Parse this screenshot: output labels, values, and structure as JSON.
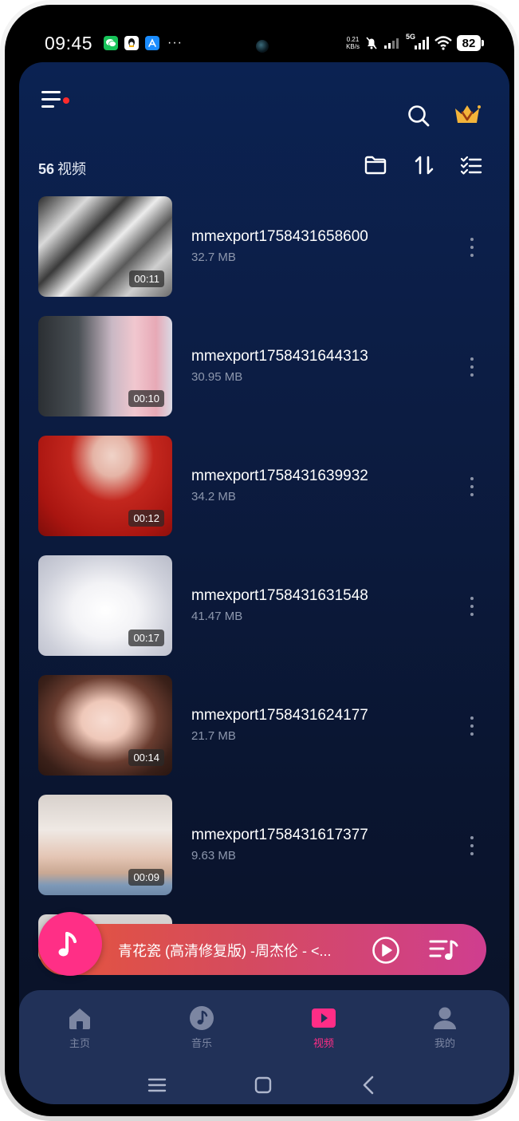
{
  "status_bar": {
    "time": "09:45",
    "net_speed_value": "0.21",
    "net_speed_unit": "KB/s",
    "signal_tag": "5G",
    "battery": "82",
    "more": "···"
  },
  "header": {
    "menu_icon": "menu-icon",
    "search_icon": "search-icon",
    "vip_icon": "crown-icon"
  },
  "toolbar": {
    "count": "56",
    "count_unit": "视频",
    "folder_icon": "folder-icon",
    "sort_icon": "sort-icon",
    "select_icon": "checklist-icon"
  },
  "videos": [
    {
      "title": "mmexport1758431658600",
      "size": "32.7 MB",
      "duration": "00:11"
    },
    {
      "title": "mmexport1758431644313",
      "size": "30.95 MB",
      "duration": "00:10"
    },
    {
      "title": "mmexport1758431639932",
      "size": "34.2 MB",
      "duration": "00:12"
    },
    {
      "title": "mmexport1758431631548",
      "size": "41.47 MB",
      "duration": "00:17"
    },
    {
      "title": "mmexport1758431624177",
      "size": "21.7 MB",
      "duration": "00:14"
    },
    {
      "title": "mmexport1758431617377",
      "size": "9.63 MB",
      "duration": "00:09"
    }
  ],
  "player": {
    "now_playing": "青花瓷 (高清修复版) -周杰伦 - <...",
    "play_icon": "play-circle-icon",
    "queue_icon": "playlist-icon"
  },
  "bottom_nav": {
    "tabs": [
      {
        "label": "主页",
        "icon": "home-icon",
        "active": false
      },
      {
        "label": "音乐",
        "icon": "music-icon",
        "active": false
      },
      {
        "label": "视频",
        "icon": "video-icon",
        "active": true
      },
      {
        "label": "我的",
        "icon": "user-icon",
        "active": false
      }
    ]
  },
  "colors": {
    "accent": "#ff2d86",
    "background_top": "#0b2252",
    "background_bottom": "#0a1226",
    "nav_bg": "#213158",
    "muted_text": "#8d97ad"
  }
}
